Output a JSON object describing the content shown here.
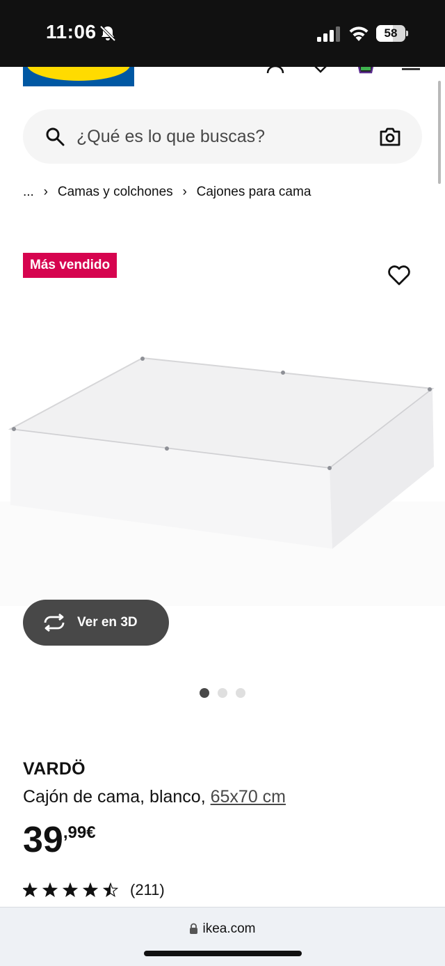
{
  "status_bar": {
    "time": "11:06",
    "battery": "58",
    "battery_level": 0.58
  },
  "search": {
    "placeholder": "¿Qué es lo que buscas?"
  },
  "breadcrumb": {
    "ellipsis": "...",
    "items": [
      "Camas y colchones",
      "Cajones para cama"
    ]
  },
  "badge": "Más vendido",
  "view3d": {
    "label": "Ver en 3D"
  },
  "carousel": {
    "total": 3,
    "active": 1
  },
  "product": {
    "name": "VARDÖ",
    "description": "Cajón de cama, blanco, ",
    "measure": "65x70 cm",
    "price_integer": "39",
    "price_decimal": ",99€",
    "rating": 4.5,
    "review_count": "(211)"
  },
  "browser": {
    "url": "ikea.com"
  },
  "colors": {
    "badge": "#d6044f",
    "brand_blue": "#0058a3",
    "brand_yellow": "#ffdb00",
    "button_dark": "#484848"
  }
}
